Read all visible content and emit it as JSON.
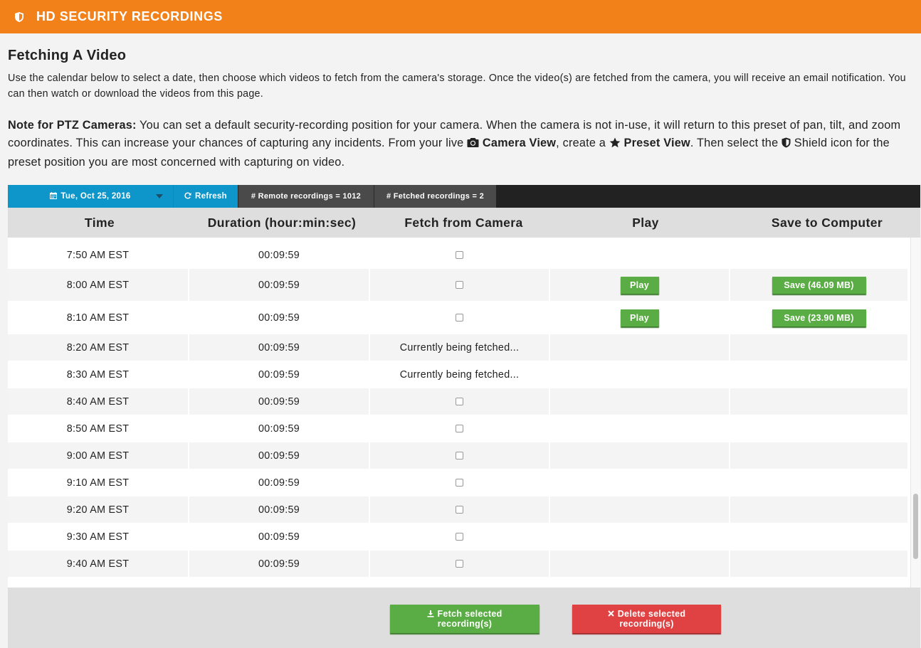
{
  "app": {
    "title": "HD SECURITY RECORDINGS",
    "icon": "shield-icon"
  },
  "content": {
    "heading": "Fetching A Video",
    "intro": "Use the calendar below to select a date, then choose which videos to fetch from the camera's storage. Once the video(s) are fetched from the camera, you will receive an email notification. You can then watch or download the videos from this page.",
    "note": {
      "label": "Note for PTZ Cameras:",
      "text1": " You can set a default security-recording position for your camera. When the camera is not in-use, it will return to this preset of pan, tilt, and zoom coordinates. This can increase your chances of capturing any incidents. From your live ",
      "camera_view": "Camera View",
      "text2": ", create a ",
      "preset_view": "Preset View",
      "text3": ". Then select the ",
      "text4": " Shield icon for the preset position you are most concerned with capturing on video."
    }
  },
  "toolbar": {
    "date": "Tue, Oct 25, 2016",
    "refresh": "Refresh",
    "remote": "# Remote recordings = 1012",
    "fetched": "# Fetched recordings = 2"
  },
  "table": {
    "headers": {
      "time": "Time",
      "duration": "Duration (hour:min:sec)",
      "fetch": "Fetch from Camera",
      "play": "Play",
      "save": "Save to Computer"
    },
    "rows": [
      {
        "time": "7:50 AM EST",
        "duration": "00:09:59",
        "fetch": "checkbox"
      },
      {
        "time": "8:00 AM EST",
        "duration": "00:09:59",
        "fetch": "checkbox",
        "play": "Play",
        "save": "Save (46.09 MB)"
      },
      {
        "time": "8:10 AM EST",
        "duration": "00:09:59",
        "fetch": "checkbox",
        "play": "Play",
        "save": "Save (23.90 MB)"
      },
      {
        "time": "8:20 AM EST",
        "duration": "00:09:59",
        "fetch": "Currently being fetched..."
      },
      {
        "time": "8:30 AM EST",
        "duration": "00:09:59",
        "fetch": "Currently being fetched..."
      },
      {
        "time": "8:40 AM EST",
        "duration": "00:09:59",
        "fetch": "checkbox"
      },
      {
        "time": "8:50 AM EST",
        "duration": "00:09:59",
        "fetch": "checkbox"
      },
      {
        "time": "9:00 AM EST",
        "duration": "00:09:59",
        "fetch": "checkbox"
      },
      {
        "time": "9:10 AM EST",
        "duration": "00:09:59",
        "fetch": "checkbox"
      },
      {
        "time": "9:20 AM EST",
        "duration": "00:09:59",
        "fetch": "checkbox"
      },
      {
        "time": "9:30 AM EST",
        "duration": "00:09:59",
        "fetch": "checkbox"
      },
      {
        "time": "9:40 AM EST",
        "duration": "00:09:59",
        "fetch": "checkbox"
      }
    ]
  },
  "footer": {
    "fetch_selected": [
      "Fetch selected",
      "recording(s)"
    ],
    "delete_selected": [
      "Delete selected",
      "recording(s)"
    ]
  },
  "colors": {
    "brand_orange": "#f28119",
    "toolbar_blue": "#0e95c9",
    "button_green": "#5aac44",
    "button_red": "#e04142"
  }
}
